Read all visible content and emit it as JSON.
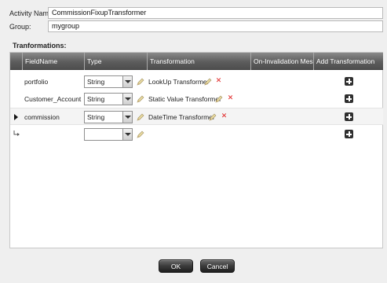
{
  "form": {
    "activity_name_label": "Activity Name:",
    "activity_name_value": "CommissionFixupTransformer",
    "group_label": "Group:",
    "group_value": "mygroup"
  },
  "section_title": "Tranformations:",
  "columns": [
    "FieldName",
    "Type",
    "Transformation",
    "On-Invalidation Message",
    "Add Transformation"
  ],
  "rows": [
    {
      "field": "portfolio",
      "type": "String",
      "transformation": "LookUp Transformer",
      "selected": false
    },
    {
      "field": "Customer_Account",
      "type": "String",
      "transformation": "Static Value Transformer",
      "selected": false
    },
    {
      "field": "commission",
      "type": "String",
      "transformation": "DateTime Transformer",
      "selected": true
    },
    {
      "field": "",
      "type": "",
      "transformation": "",
      "selected": false
    }
  ],
  "buttons": {
    "ok": "OK",
    "cancel": "Cancel"
  },
  "colors": {
    "header_bg": "#5d5d5d",
    "delete_icon": "#e02020",
    "button_bg": "#2f2f2f"
  }
}
